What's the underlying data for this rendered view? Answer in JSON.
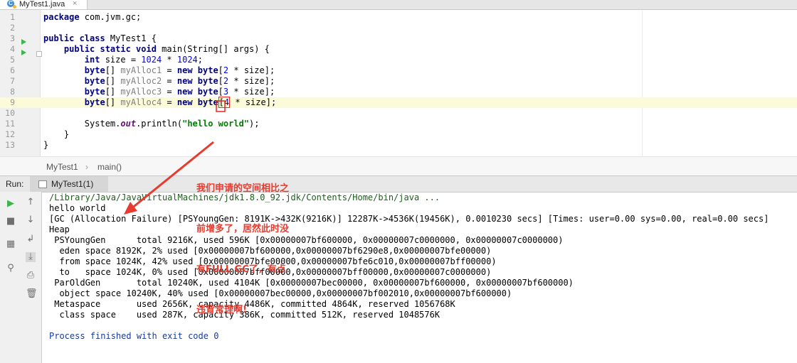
{
  "tab": {
    "file_name": "MyTest1.java",
    "icon": "c-class-icon",
    "close_glyph": "×"
  },
  "editor": {
    "lines": [
      {
        "n": "1",
        "html": "<span class=\"kw\">package</span> com.jvm.gc;"
      },
      {
        "n": "2",
        "html": ""
      },
      {
        "n": "3",
        "html": "<span class=\"kw\">public class</span> MyTest1 {"
      },
      {
        "n": "4",
        "html": "    <span class=\"kw\">public static void</span> main(String[] args) {"
      },
      {
        "n": "5",
        "html": "        <span class=\"kw\">int</span> size = <span class=\"num\">1024</span> * <span class=\"num\">1024</span>;"
      },
      {
        "n": "6",
        "html": "        <span class=\"kw\">byte</span>[] <span class=\"unused\">myAlloc1</span> = <span class=\"kw\">new byte</span>[<span class=\"num\">2</span> * size];"
      },
      {
        "n": "7",
        "html": "        <span class=\"kw\">byte</span>[] <span class=\"unused\">myAlloc2</span> = <span class=\"kw\">new byte</span>[<span class=\"num\">2</span> * size];"
      },
      {
        "n": "8",
        "html": "        <span class=\"kw\">byte</span>[] <span class=\"unused\">myAlloc3</span> = <span class=\"kw\">new byte</span>[<span class=\"num\">3</span> * size];"
      },
      {
        "n": "9",
        "html": "        <span class=\"kw\">byte</span>[] <span class=\"unused\">myAlloc4</span> = <span class=\"kw\">new byte</span><span class=\"box\">[<span class=\"num\">4</span></span> * size];"
      },
      {
        "n": "10",
        "html": ""
      },
      {
        "n": "11",
        "html": "        System.<span class=\"fld\">out</span>.println(<span class=\"str\">\"hello world\"</span>);"
      },
      {
        "n": "12",
        "html": "    }"
      },
      {
        "n": "13",
        "html": "}"
      }
    ],
    "highlight_line": "9"
  },
  "breadcrumb": {
    "class_name": "MyTest1",
    "arrow": "›",
    "method": "main()"
  },
  "run_panel": {
    "label": "Run:",
    "tab_name": "MyTest1(1)",
    "close_glyph": "×"
  },
  "console_lines": [
    {
      "cls": "cmd",
      "text": "/Library/Java/JavaVirtualMachines/jdk1.8.0_92.jdk/Contents/Home/bin/java ..."
    },
    {
      "cls": "",
      "text": "hello world"
    },
    {
      "cls": "",
      "text": "[GC (Allocation Failure) [PSYoungGen: 8191K->432K(9216K)] 12287K->4536K(19456K), 0.0010230 secs] [Times: user=0.00 sys=0.00, real=0.00 secs]"
    },
    {
      "cls": "",
      "text": "Heap"
    },
    {
      "cls": "",
      "text": " PSYoungGen      total 9216K, used 596K [0x00000007bf600000, 0x00000007c0000000, 0x00000007c0000000)"
    },
    {
      "cls": "",
      "text": "  eden space 8192K, 2% used [0x00000007bf600000,0x00000007bf6290e8,0x00000007bfe00000)"
    },
    {
      "cls": "",
      "text": "  from space 1024K, 42% used [0x00000007bfe00000,0x00000007bfe6c010,0x00000007bff00000)"
    },
    {
      "cls": "",
      "text": "  to   space 1024K, 0% used [0x00000007bff00000,0x00000007bff00000,0x00000007c0000000)"
    },
    {
      "cls": "",
      "text": " ParOldGen       total 10240K, used 4104K [0x00000007bec00000, 0x00000007bf600000, 0x00000007bf600000)"
    },
    {
      "cls": "",
      "text": "  object space 10240K, 40% used [0x00000007bec00000,0x00000007bf002010,0x00000007bf600000)"
    },
    {
      "cls": "",
      "text": " Metaspace       used 2656K, capacity 4486K, committed 4864K, reserved 1056768K"
    },
    {
      "cls": "",
      "text": "  class space    used 287K, capacity 386K, committed 512K, reserved 1048576K"
    },
    {
      "cls": "",
      "text": ""
    },
    {
      "cls": "fin",
      "text": "Process finished with exit code 0"
    }
  ],
  "annotation": {
    "lines": [
      "我们申请的空间相比之",
      "前增多了，居然此时没",
      "有FULL GC了，有点",
      "违背常理啊!"
    ],
    "color": "#e63b2e"
  },
  "colors": {
    "keyword": "#000080",
    "number": "#0000ff",
    "string": "#008000",
    "run_green": "#3db54a",
    "highlight": "#fcfbd9"
  },
  "toolbar_icons": [
    "rerun-icon",
    "stop-icon",
    "layout-icon",
    "pin-icon",
    "up-arrow-icon",
    "down-arrow-icon",
    "soft-wrap-icon",
    "scroll-to-end-icon",
    "print-icon",
    "trash-icon"
  ]
}
